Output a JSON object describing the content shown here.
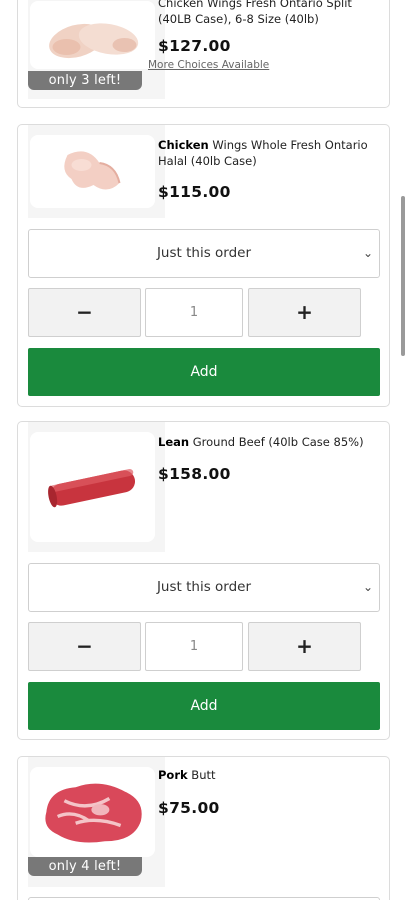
{
  "products": [
    {
      "title_rest": "Chicken Wings Fresh Ontario Split (40LB Case), 6-8 Size (40lb)",
      "price": "$127.00",
      "more_choices": "More Choices Available",
      "badge": "only 3 left!",
      "image_icon": "chicken-wings-icon"
    },
    {
      "title_bold": "Chicken",
      "title_rest": " Wings Whole Fresh Ontario Halal (40lb Case)",
      "price": "$115.00",
      "frequency": "Just this order",
      "quantity": "1",
      "minus_label": "−",
      "plus_label": "+",
      "add_label": "Add",
      "image_icon": "chicken-wing-icon"
    },
    {
      "title_bold": "Lean",
      "title_rest": " Ground Beef (40lb Case 85%)",
      "price": "$158.00",
      "frequency": "Just this order",
      "quantity": "1",
      "minus_label": "−",
      "plus_label": "+",
      "add_label": "Add",
      "image_icon": "ground-beef-roll-icon"
    },
    {
      "title_bold": "Pork",
      "title_rest": " Butt",
      "price": "$75.00",
      "badge": "only 4 left!",
      "image_icon": "pork-butt-icon"
    }
  ],
  "colors": {
    "add_green": "#1a8a3d",
    "badge_gray": "#787878"
  }
}
